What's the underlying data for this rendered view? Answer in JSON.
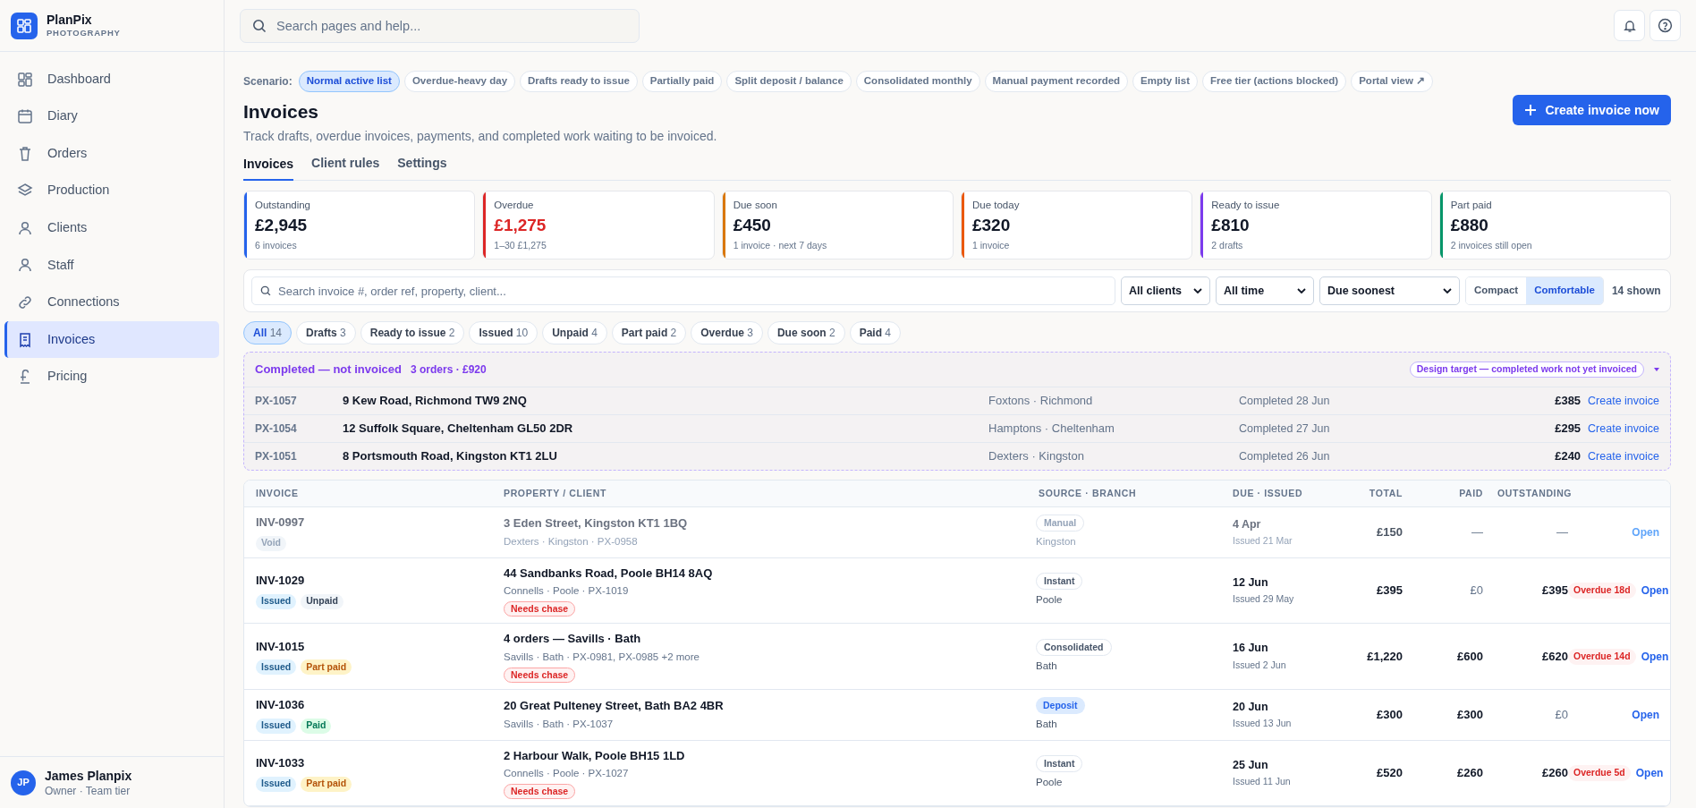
{
  "brand": {
    "name": "PlanPix",
    "tagline": "PHOTOGRAPHY"
  },
  "search": {
    "placeholder": "Search pages and help..."
  },
  "sidebar": {
    "items": [
      {
        "label": "Dashboard",
        "selected": false
      },
      {
        "label": "Diary",
        "selected": false
      },
      {
        "label": "Orders",
        "selected": false
      },
      {
        "label": "Production",
        "selected": false
      },
      {
        "label": "Clients",
        "selected": false
      },
      {
        "label": "Staff",
        "selected": false
      },
      {
        "label": "Connections",
        "selected": false
      },
      {
        "label": "Invoices",
        "selected": true
      },
      {
        "label": "Pricing",
        "selected": false
      }
    ],
    "user": {
      "initials": "JP",
      "name": "James Planpix",
      "role": "Owner · Team tier"
    }
  },
  "scenario": {
    "label": "Scenario:",
    "options": [
      {
        "label": "Normal active list",
        "selected": true
      },
      {
        "label": "Overdue-heavy day",
        "selected": false
      },
      {
        "label": "Drafts ready to issue",
        "selected": false
      },
      {
        "label": "Partially paid",
        "selected": false
      },
      {
        "label": "Split deposit / balance",
        "selected": false
      },
      {
        "label": "Consolidated monthly",
        "selected": false
      },
      {
        "label": "Manual payment recorded",
        "selected": false
      },
      {
        "label": "Empty list",
        "selected": false
      },
      {
        "label": "Free tier (actions blocked)",
        "selected": false
      },
      {
        "label": "Portal view ↗",
        "selected": false
      }
    ]
  },
  "page": {
    "title": "Invoices",
    "subtitle": "Track drafts, overdue invoices, payments, and completed work waiting to be invoiced.",
    "primary_button": "Create invoice now"
  },
  "tabs": [
    {
      "label": "Invoices",
      "selected": true
    },
    {
      "label": "Client rules",
      "selected": false
    },
    {
      "label": "Settings",
      "selected": false
    }
  ],
  "cards": [
    {
      "label": "Outstanding",
      "value": "£2,945",
      "note": "6 invoices",
      "color": "#2563eb",
      "alert": false
    },
    {
      "label": "Overdue",
      "value": "£1,275",
      "note": "1–30 £1,275",
      "color": "#dc2626",
      "alert": true
    },
    {
      "label": "Due soon",
      "value": "£450",
      "note": "1 invoice · next 7 days",
      "color": "#d97706",
      "alert": false
    },
    {
      "label": "Due today",
      "value": "£320",
      "note": "1 invoice",
      "color": "#ea580c",
      "alert": false
    },
    {
      "label": "Ready to issue",
      "value": "£810",
      "note": "2 drafts",
      "color": "#7c3aed",
      "alert": false
    },
    {
      "label": "Part paid",
      "value": "£880",
      "note": "2 invoices still open",
      "color": "#059669",
      "alert": false
    }
  ],
  "filters": {
    "search_placeholder": "Search invoice #, order ref, property, client...",
    "selects": [
      "All clients",
      "All time",
      "Due soonest"
    ],
    "density": [
      {
        "label": "Compact",
        "selected": false
      },
      {
        "label": "Comfortable",
        "selected": true
      }
    ],
    "shown": "14 shown"
  },
  "chips": [
    {
      "label": "All",
      "count": "14",
      "selected": true
    },
    {
      "label": "Drafts",
      "count": "3",
      "selected": false
    },
    {
      "label": "Ready to issue",
      "count": "2",
      "selected": false
    },
    {
      "label": "Issued",
      "count": "10",
      "selected": false
    },
    {
      "label": "Unpaid",
      "count": "4",
      "selected": false
    },
    {
      "label": "Part paid",
      "count": "2",
      "selected": false
    },
    {
      "label": "Overdue",
      "count": "3",
      "selected": false
    },
    {
      "label": "Due soon",
      "count": "2",
      "selected": false
    },
    {
      "label": "Paid",
      "count": "4",
      "selected": false
    }
  ],
  "completed": {
    "title": "Completed — not invoiced",
    "summary": "3 orders · £920",
    "badge": "Design target — completed work not yet invoiced",
    "rows": [
      {
        "ref": "PX-1057",
        "address": "9 Kew Road, Richmond TW9 2NQ",
        "client": "Foxtons · Richmond",
        "completed": "Completed 28 Jun",
        "amount": "£385",
        "action": "Create invoice"
      },
      {
        "ref": "PX-1054",
        "address": "12 Suffolk Square, Cheltenham GL50 2DR",
        "client": "Hamptons · Cheltenham",
        "completed": "Completed 27 Jun",
        "amount": "£295",
        "action": "Create invoice"
      },
      {
        "ref": "PX-1051",
        "address": "8 Portsmouth Road, Kingston KT1 2LU",
        "client": "Dexters · Kingston",
        "completed": "Completed 26 Jun",
        "amount": "£240",
        "action": "Create invoice"
      }
    ]
  },
  "table": {
    "columns": [
      "INVOICE",
      "PROPERTY / CLIENT",
      "SOURCE · BRANCH",
      "DUE · ISSUED",
      "TOTAL",
      "PAID",
      "OUTSTANDING"
    ],
    "rows": [
      {
        "invoice": "INV-0997",
        "muted": true,
        "tags": [
          {
            "label": "Void",
            "kind": "void"
          }
        ],
        "property": "3 Eden Street, Kingston KT1 1BQ",
        "client": "Dexters · Kingston · PX-0958",
        "chase": null,
        "source": {
          "label": "Manual",
          "kind": "manual"
        },
        "branch": "Kingston",
        "due": "4 Apr",
        "issued": "Issued 21 Mar",
        "total": "£150",
        "paid": {
          "text": "—",
          "strong": false
        },
        "outstanding": {
          "text": "—",
          "strong": false
        },
        "overdue": null,
        "action": "Open"
      },
      {
        "invoice": "INV-1029",
        "muted": false,
        "tags": [
          {
            "label": "Issued",
            "kind": "issued"
          },
          {
            "label": "Unpaid",
            "kind": "unpaid"
          }
        ],
        "property": "44 Sandbanks Road, Poole BH14 8AQ",
        "client": "Connells · Poole · PX-1019",
        "chase": "Needs chase",
        "source": {
          "label": "Instant",
          "kind": "outline"
        },
        "branch": "Poole",
        "due": "12 Jun",
        "issued": "Issued 29 May",
        "total": "£395",
        "paid": {
          "text": "£0",
          "strong": false
        },
        "outstanding": {
          "text": "£395",
          "strong": true
        },
        "overdue": "Overdue 18d",
        "action": "Open"
      },
      {
        "invoice": "INV-1015",
        "muted": false,
        "tags": [
          {
            "label": "Issued",
            "kind": "issued"
          },
          {
            "label": "Part paid",
            "kind": "part_paid"
          }
        ],
        "property": "4 orders — Savills · Bath",
        "client": "Savills · Bath · PX-0981, PX-0985 +2 more",
        "chase": "Needs chase",
        "source": {
          "label": "Consolidated",
          "kind": "outline"
        },
        "branch": "Bath",
        "due": "16 Jun",
        "issued": "Issued 2 Jun",
        "total": "£1,220",
        "paid": {
          "text": "£600",
          "strong": true
        },
        "outstanding": {
          "text": "£620",
          "strong": true
        },
        "overdue": "Overdue 14d",
        "action": "Open"
      },
      {
        "invoice": "INV-1036",
        "muted": false,
        "tags": [
          {
            "label": "Issued",
            "kind": "issued"
          },
          {
            "label": "Paid",
            "kind": "paid"
          }
        ],
        "property": "20 Great Pulteney Street, Bath BA2 4BR",
        "client": "Savills · Bath · PX-1037",
        "chase": null,
        "source": {
          "label": "Deposit",
          "kind": "deposit"
        },
        "branch": "Bath",
        "due": "20 Jun",
        "issued": "Issued 13 Jun",
        "total": "£300",
        "paid": {
          "text": "£300",
          "strong": true
        },
        "outstanding": {
          "text": "£0",
          "strong": false
        },
        "overdue": null,
        "action": "Open"
      },
      {
        "invoice": "INV-1033",
        "muted": false,
        "tags": [
          {
            "label": "Issued",
            "kind": "issued"
          },
          {
            "label": "Part paid",
            "kind": "part_paid"
          }
        ],
        "property": "2 Harbour Walk, Poole BH15 1LD",
        "client": "Connells · Poole · PX-1027",
        "chase": "Needs chase",
        "source": {
          "label": "Instant",
          "kind": "outline"
        },
        "branch": "Poole",
        "due": "25 Jun",
        "issued": "Issued 11 Jun",
        "total": "£520",
        "paid": {
          "text": "£260",
          "strong": true
        },
        "outstanding": {
          "text": "£260",
          "strong": true
        },
        "overdue": "Overdue 5d",
        "action": "Open"
      }
    ]
  }
}
